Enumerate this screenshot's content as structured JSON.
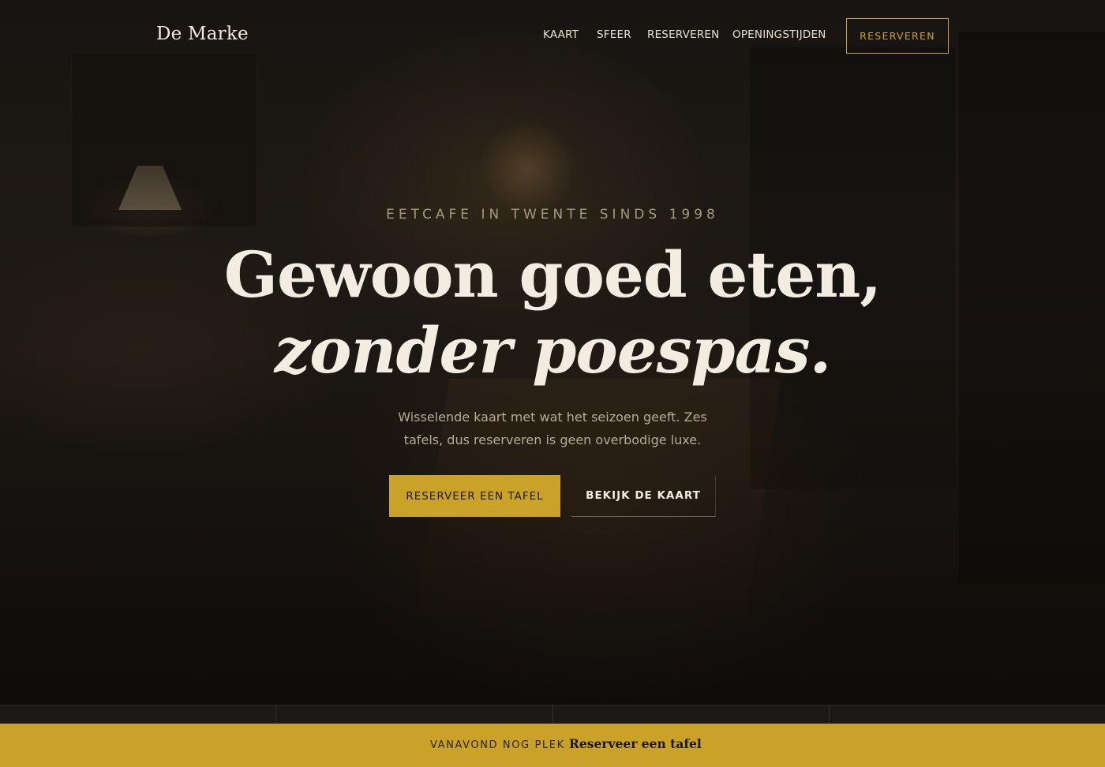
{
  "header": {
    "brand": "De Marke",
    "nav": [
      "KAART",
      "SFEER",
      "RESERVEREN",
      "OPENINGSTIJDEN"
    ],
    "cta": "RESERVEREN"
  },
  "hero": {
    "eyebrow": "EETCAFE IN TWENTE SINDS 1998",
    "headline_line1": "Gewoon goed eten,",
    "headline_line2": "zonder poespas.",
    "subtitle": "Wisselende kaart met wat het seizoen geeft. Zes tafels, dus reserveren is geen overbodige luxe.",
    "primary_button": "RESERVEER EEN TAFEL",
    "secondary_button": "BEKIJK DE KAART"
  },
  "bottom_bar": {
    "label": "VANAVOND NOG PLEK",
    "link": "Reserveer een tafel"
  },
  "colors": {
    "accent": "#c9a227",
    "text_light": "#f3ece0",
    "background": "#141210"
  }
}
